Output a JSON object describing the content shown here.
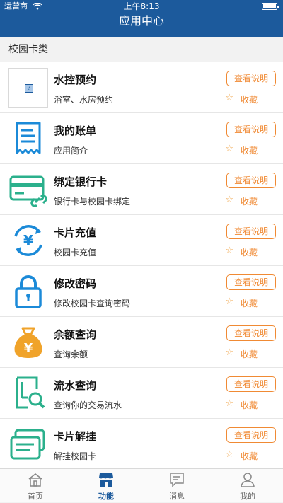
{
  "status": {
    "carrier": "运营商",
    "time": "上午8:13"
  },
  "header": {
    "title": "应用中心"
  },
  "section": {
    "title": "校园卡类"
  },
  "items": [
    {
      "name": "水控预约",
      "desc": "浴室、水房预约",
      "button": "查看说明",
      "fav": "收藏",
      "icon": "image-placeholder-icon"
    },
    {
      "name": "我的账单",
      "desc": "应用简介",
      "button": "查看说明",
      "fav": "收藏",
      "icon": "receipt-icon"
    },
    {
      "name": "绑定银行卡",
      "desc": "银行卡与校园卡绑定",
      "button": "查看说明",
      "fav": "收藏",
      "icon": "bank-card-link-icon"
    },
    {
      "name": "卡片充值",
      "desc": "校园卡充值",
      "button": "查看说明",
      "fav": "收藏",
      "icon": "yen-refresh-icon"
    },
    {
      "name": "修改密码",
      "desc": "修改校园卡查询密码",
      "button": "查看说明",
      "fav": "收藏",
      "icon": "lock-icon"
    },
    {
      "name": "余额查询",
      "desc": "查询余额",
      "button": "查看说明",
      "fav": "收藏",
      "icon": "money-bag-icon"
    },
    {
      "name": "流水查询",
      "desc": "查询你的交易流水",
      "button": "查看说明",
      "fav": "收藏",
      "icon": "document-search-icon"
    },
    {
      "name": "卡片解挂",
      "desc": "解挂校园卡",
      "button": "查看说明",
      "fav": "收藏",
      "icon": "cards-icon"
    }
  ],
  "tabs": [
    {
      "label": "首页",
      "icon": "home-icon",
      "active": false
    },
    {
      "label": "功能",
      "icon": "store-icon",
      "active": true
    },
    {
      "label": "消息",
      "icon": "message-icon",
      "active": false
    },
    {
      "label": "我的",
      "icon": "user-icon",
      "active": false
    }
  ],
  "colors": {
    "header": "#1c5a9c",
    "accent": "#f08a34",
    "blue_icon": "#1b8ad8",
    "green_icon": "#2bb08c",
    "orange_icon": "#f0a32a"
  }
}
